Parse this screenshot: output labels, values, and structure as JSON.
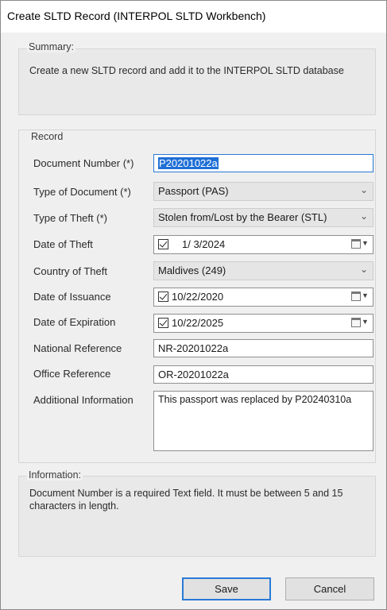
{
  "window": {
    "title": "Create SLTD Record (INTERPOL SLTD Workbench)"
  },
  "summary": {
    "legend": "Summary:",
    "text": "Create a new SLTD record and add it to the INTERPOL SLTD database"
  },
  "record": {
    "legend": "Record",
    "fields": {
      "document_number": {
        "label": "Document Number (*)",
        "value": "P20201022a"
      },
      "type_of_document": {
        "label": "Type of Document (*)",
        "value": "Passport (PAS)"
      },
      "type_of_theft": {
        "label": "Type of Theft (*)",
        "value": "Stolen from/Lost by the Bearer (STL)"
      },
      "date_of_theft": {
        "label": "Date of Theft",
        "value": "1/ 3/2024",
        "checked": true
      },
      "country_of_theft": {
        "label": "Country of Theft",
        "value": "Maldives (249)"
      },
      "date_of_issuance": {
        "label": "Date of Issuance",
        "value": "10/22/2020",
        "checked": true
      },
      "date_of_expiration": {
        "label": "Date of Expiration",
        "value": "10/22/2025",
        "checked": true
      },
      "national_reference": {
        "label": "National Reference",
        "value": "NR-20201022a"
      },
      "office_reference": {
        "label": "Office Reference",
        "value": "OR-20201022a"
      },
      "additional_information": {
        "label": "Additional Information",
        "value": "This passport was replaced by P20240310a"
      }
    }
  },
  "information": {
    "legend": "Information:",
    "text": "Document Number is a required Text field. It must be between 5 and 15 characters in length."
  },
  "buttons": {
    "save": "Save",
    "cancel": "Cancel"
  },
  "icons": {
    "dropdown": "chevron-down-icon",
    "calendar": "calendar-icon",
    "checkbox": "checkbox-checked-icon"
  },
  "colors": {
    "accent": "#2a7ad5",
    "selection": "#1f6fd6"
  }
}
